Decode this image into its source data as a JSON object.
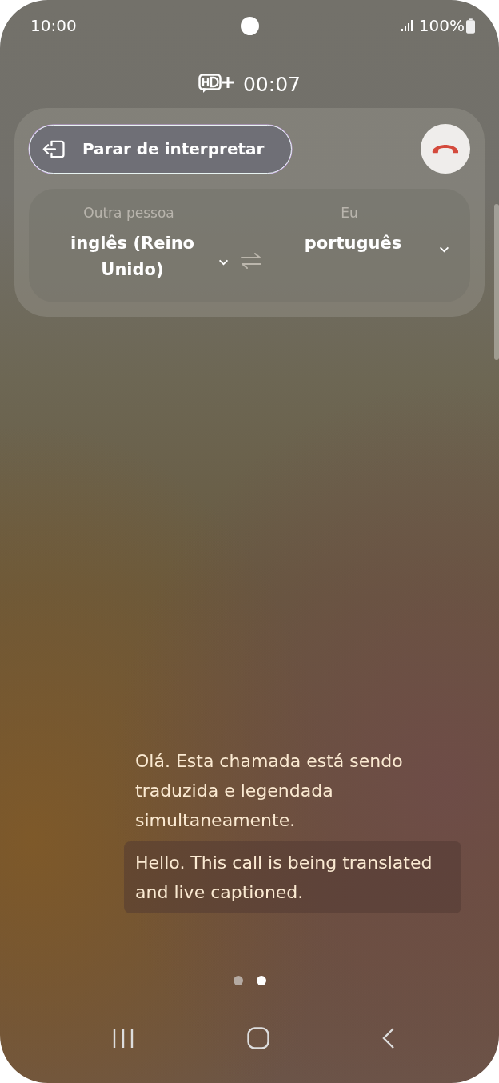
{
  "status_bar": {
    "time": "10:00",
    "battery": "100%"
  },
  "call": {
    "timer": "00:07"
  },
  "stop_button": {
    "label": "Parar de interpretar"
  },
  "languages": [
    {
      "role": "Outra pessoa",
      "language": "inglês (Reino Unido)"
    },
    {
      "role": "Eu",
      "language": "português"
    }
  ],
  "captions": [
    {
      "text": "Olá. Esta chamada está sendo traduzida e legendada simultaneamente.",
      "highlighted": false
    },
    {
      "text": "Hello. This call is being translated and live captioned.",
      "highlighted": true
    }
  ],
  "page_dots": [
    {
      "selected": false
    },
    {
      "selected": true
    }
  ]
}
